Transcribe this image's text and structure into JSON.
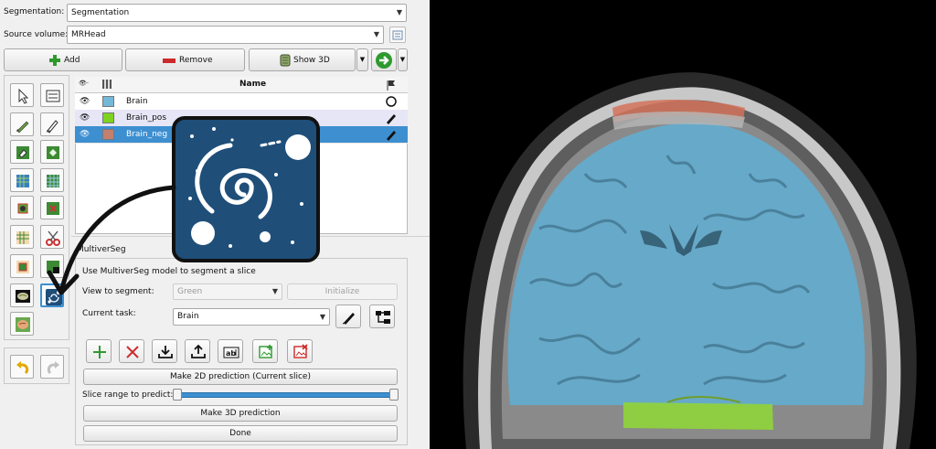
{
  "segmentation": {
    "label": "Segmentation:",
    "value": "Segmentation"
  },
  "source_volume": {
    "label": "Source volume:",
    "value": "MRHead"
  },
  "actions": {
    "add": "Add",
    "remove": "Remove",
    "show3d": "Show 3D"
  },
  "table": {
    "header_name": "Name",
    "rows": [
      {
        "name": "Brain",
        "color": "#74b8d8",
        "state": "circle"
      },
      {
        "name": "Brain_pos",
        "color": "#7ed321",
        "state": "pencil"
      },
      {
        "name": "Brain_neg",
        "color": "#c47f6e",
        "state": "pencil"
      }
    ]
  },
  "multiverseg": {
    "section_title": "MultiverSeg",
    "description": "Use MultiverSeg model to segment a slice",
    "view_label": "View to segment:",
    "view_value": "Green",
    "initialize": "Initialize",
    "task_label": "Current task:",
    "task_value": "Brain",
    "predict_2d": "Make 2D prediction (Current slice)",
    "slice_range_label": "Slice range to predict:",
    "slice_range": [
      0,
      1
    ],
    "predict_3d": "Make 3D prediction",
    "done": "Done"
  },
  "colors": {
    "selected_row": "#3d8fd0",
    "hover_row": "#e6e6f6",
    "logo_bg": "#1f4e79",
    "overlay_blue": "#5fb0d6",
    "overlay_green": "#8fd43a",
    "overlay_red": "#d4735a"
  }
}
